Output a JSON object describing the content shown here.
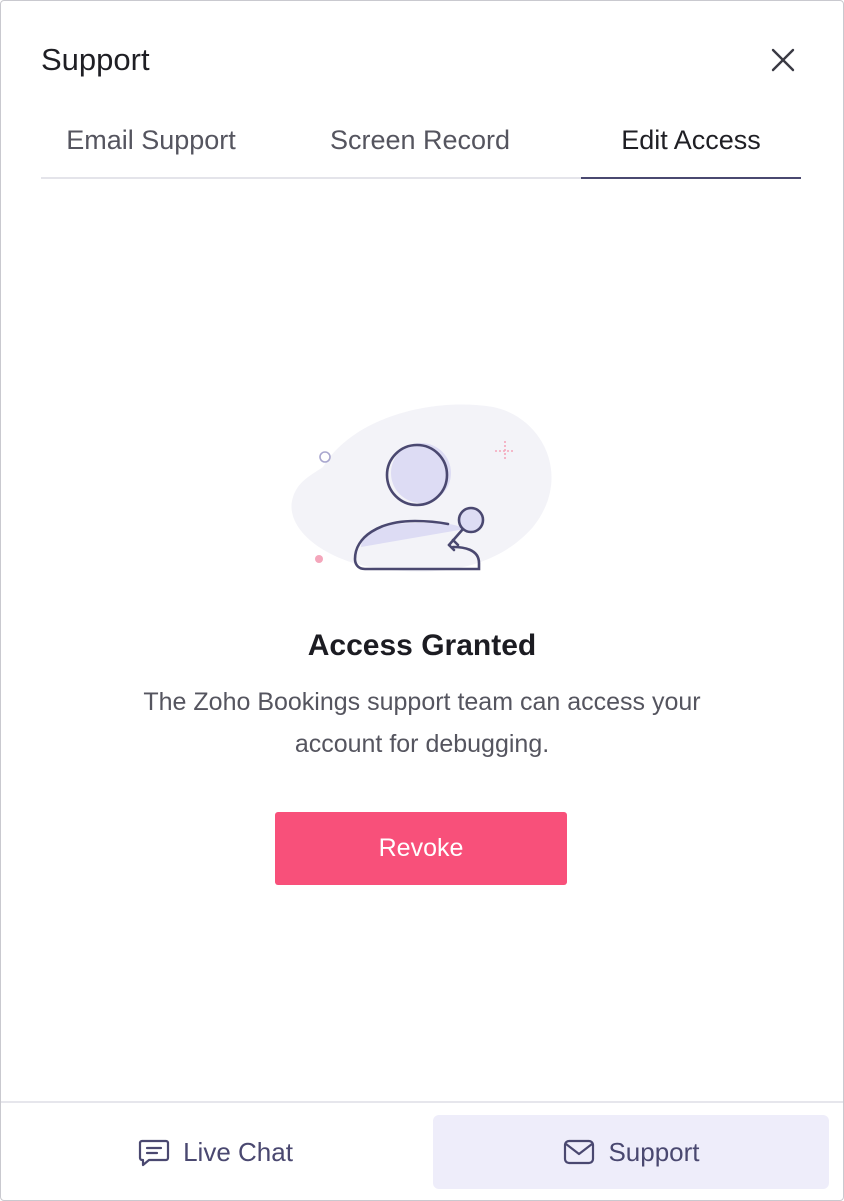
{
  "header": {
    "title": "Support"
  },
  "tabs": [
    {
      "label": "Email Support",
      "active": false
    },
    {
      "label": "Screen Record",
      "active": false
    },
    {
      "label": "Edit Access",
      "active": true
    }
  ],
  "content": {
    "illustration_icon": "user-key-icon",
    "title": "Access Granted",
    "description": "The Zoho Bookings support team can access your account for debugging.",
    "revoke_label": "Revoke"
  },
  "footer": {
    "live_chat_label": "Live Chat",
    "live_chat_icon": "chat-bubble-icon",
    "support_label": "Support",
    "support_icon": "envelope-icon"
  },
  "colors": {
    "accent": "#4a4870",
    "revoke": "#f8507a",
    "support_bg": "#eeedfa"
  }
}
